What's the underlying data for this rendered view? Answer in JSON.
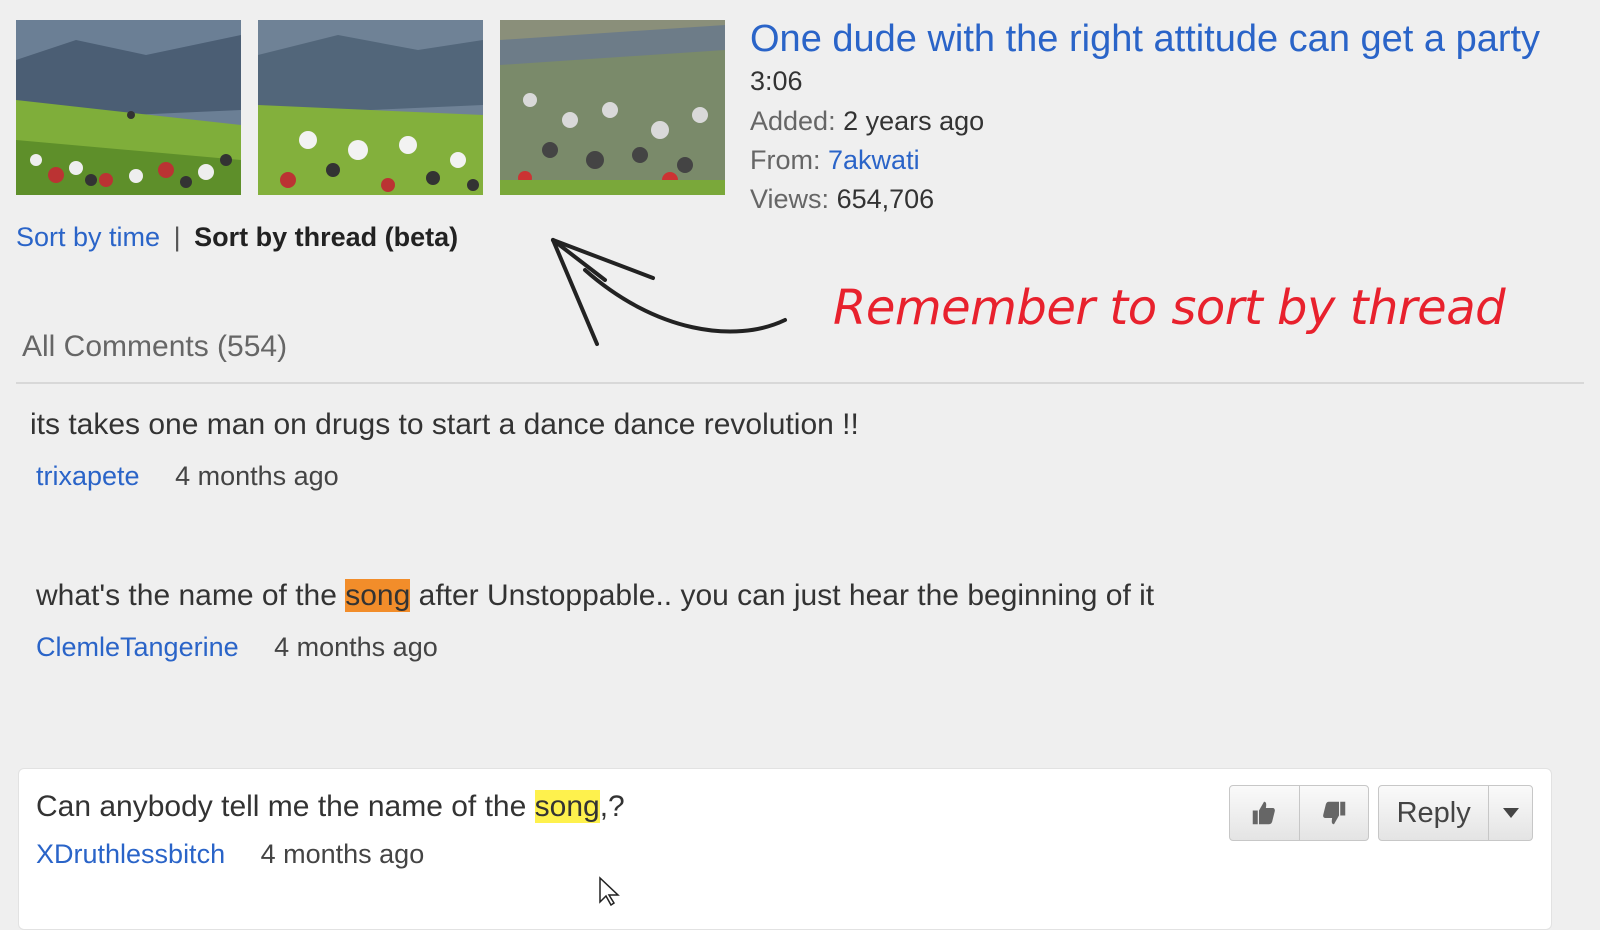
{
  "video": {
    "title": "One dude with the right attitude can get a party",
    "duration": "3:06",
    "added_label": "Added:",
    "added_value": "2 years ago",
    "from_label": "From:",
    "from_value": "7akwati",
    "views_label": "Views:",
    "views_value": "654,706"
  },
  "sort": {
    "by_time": "Sort by time",
    "separator": "|",
    "by_thread": "Sort by thread (beta)"
  },
  "annotation": "Remember to sort by thread",
  "comments_header": "All Comments (554)",
  "comments": [
    {
      "text": "its takes one man on drugs to start a dance dance revolution !!",
      "user": "trixapete",
      "time": "4 months ago"
    },
    {
      "text_before": "what's the name of the ",
      "highlight": "song",
      "text_after": " after Unstoppable.. you can just hear the beginning of it",
      "user": "ClemleTangerine",
      "time": "4 months ago"
    },
    {
      "text_before": "Can anybody tell me the name of the ",
      "highlight": "song",
      "text_after": ",?",
      "user": "XDruthlessbitch",
      "time": "4 months ago"
    }
  ],
  "buttons": {
    "thumbs_up_icon": "thumbs-up",
    "thumbs_down_icon": "thumbs-down",
    "reply": "Reply",
    "dropdown_icon": "caret-down"
  },
  "colors": {
    "link": "#2a64c8",
    "annotation": "#e8212d",
    "highlight_orange": "#f28d2a",
    "highlight_yellow": "#fef14d"
  }
}
